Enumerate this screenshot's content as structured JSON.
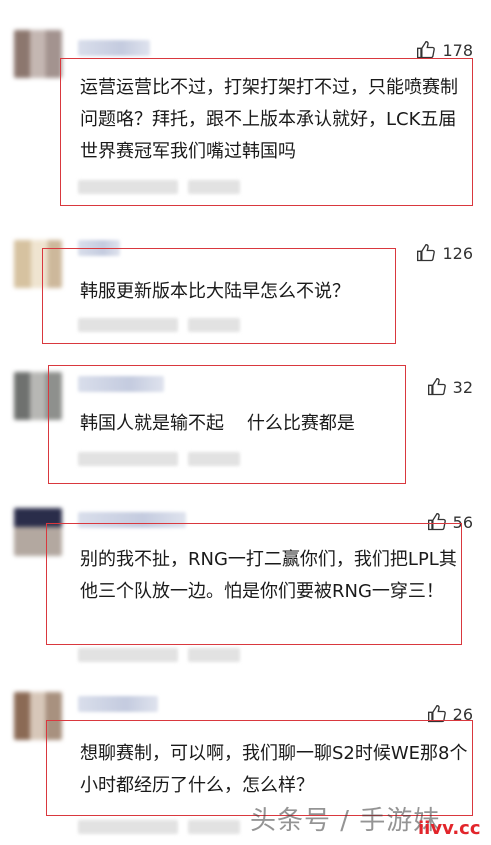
{
  "comments": [
    {
      "likes": "178",
      "text": "运营运营比不过，打架打架打不过，只能喷赛制问题咯？拜托，跟不上版本承认就好，LCK五届世界赛冠军我们嘴过韩国吗"
    },
    {
      "likes": "126",
      "text": "韩服更新版本比大陆早怎么不说？"
    },
    {
      "likes": "32",
      "text": "韩国人就是输不起    什么比赛都是"
    },
    {
      "likes": "56",
      "text": "别的我不扯，RNG一打二赢你们，我们把LPL其他三个队放一边。怕是你们要被RNG一穿三！"
    },
    {
      "likes": "26",
      "text": "想聊赛制，可以啊，我们聊一聊S2时候WE那8个小时都经历了什么，怎么样？"
    }
  ],
  "icons": {
    "like": "thumbs-up-icon"
  },
  "watermark": "头条号 / 手游妹",
  "site": "iivv.cc",
  "colors": {
    "highlight": "#d9383e",
    "site": "#e2252b"
  }
}
